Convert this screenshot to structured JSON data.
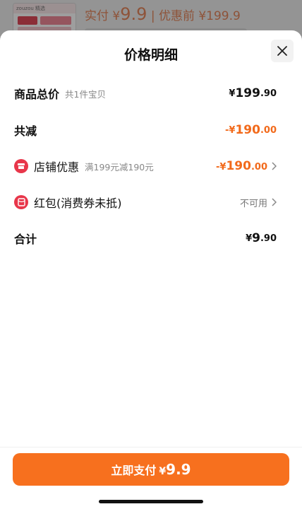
{
  "background": {
    "thumb_caption": "zouzou 精选",
    "price_prefix": "实付 ¥",
    "price_big": "9",
    "price_dec": ".9",
    "price_original": "| 优惠前 ¥199.9"
  },
  "sheet": {
    "title": "价格明细",
    "close_icon": "close-icon"
  },
  "rows": {
    "total": {
      "label": "商品总价",
      "sub": "共1件宝贝",
      "yen": "¥",
      "int": "199",
      "dec": ".90"
    },
    "reduce": {
      "label": "共减",
      "yen": "-¥",
      "int": "190",
      "dec": ".00"
    },
    "store": {
      "label": "店铺优惠",
      "sub": "满199元减190元",
      "yen": "-¥",
      "int": "190",
      "dec": ".00"
    },
    "redpack": {
      "label": "红包(消费券未抵)",
      "status": "不可用"
    },
    "sum": {
      "label": "合计",
      "yen": "¥",
      "int": "9",
      "dec": ".90"
    }
  },
  "footer": {
    "pay_label": "立即支付",
    "pay_yen": "¥",
    "pay_amount": "9.9"
  },
  "colors": {
    "accent": "#f7701e",
    "discount": "#f26a1b",
    "icon_red": "#e8364a"
  }
}
